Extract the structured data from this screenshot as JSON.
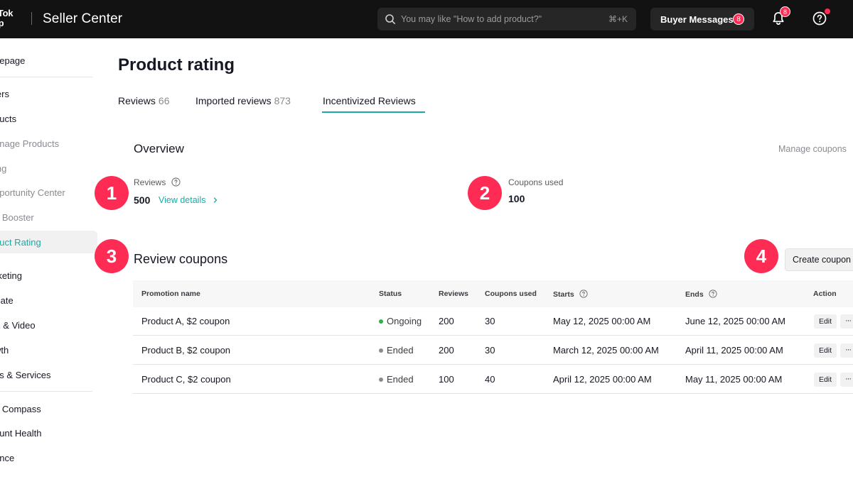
{
  "topbar": {
    "logo_line1": "kTok",
    "logo_line2": "op",
    "brand": "Seller Center",
    "search_placeholder": "You may like \"How to add product?\"",
    "search_shortcut": "⌘+K",
    "buyer_messages_label": "Buyer Messages",
    "buyer_messages_count": "8",
    "notifications_count": "8",
    "icons": [
      "search-icon",
      "bell-icon",
      "help-icon"
    ]
  },
  "sidebar": {
    "items": [
      {
        "label": "nepage"
      },
      {
        "label": "lers"
      },
      {
        "label": "ducts"
      },
      {
        "label": "anage Products"
      },
      {
        "label": "ing"
      },
      {
        "label": "oportunity Center"
      },
      {
        "label": "e Booster"
      },
      {
        "label": "duct Rating"
      },
      {
        "label": "rketing"
      },
      {
        "label": "iliate"
      },
      {
        "label": "E & Video"
      },
      {
        "label": "wth"
      },
      {
        "label": "os & Services"
      },
      {
        "label": "a Compass"
      },
      {
        "label": "ount Health"
      },
      {
        "label": "ance"
      }
    ],
    "active_item": "duct Rating"
  },
  "main": {
    "title": "Product rating",
    "tabs": [
      {
        "label": "Reviews",
        "count": "66"
      },
      {
        "label": "Imported reviews",
        "count": "873"
      },
      {
        "label": "Incentivized Reviews",
        "count": ""
      }
    ],
    "active_tab": "Incentivized Reviews",
    "overview": {
      "title": "Overview",
      "manage_link": "Manage coupons",
      "reviews_label": "Reviews",
      "reviews_value": "500",
      "view_details": "View details",
      "coupons_used_label": "Coupons used",
      "coupons_used_value": "100"
    },
    "markers": [
      "1",
      "2",
      "3",
      "4"
    ],
    "review_coupons": {
      "title": "Review coupons",
      "create_button": "Create coupon",
      "columns": [
        "Promotion name",
        "Status",
        "Reviews",
        "Coupons used",
        "Starts",
        "Ends",
        "Action"
      ],
      "rows": [
        {
          "name": "Product A, $2 coupon",
          "status": "Ongoing",
          "status_color": "#2bb34b",
          "reviews": "200",
          "coupons_used": "30",
          "starts": "May 12, 2025 00:00 AM",
          "ends": "June 12, 2025 00:00 AM",
          "edit": "Edit",
          "more": "···"
        },
        {
          "name": "Product B, $2 coupon",
          "status": "Ended",
          "status_color": "#8a8b91",
          "reviews": "200",
          "coupons_used": "30",
          "starts": "March 12, 2025 00:00 AM",
          "ends": "April 11, 2025 00:00 AM",
          "edit": "Edit",
          "more": "···"
        },
        {
          "name": "Product C, $2 coupon",
          "status": "Ended",
          "status_color": "#8a8b91",
          "reviews": "100",
          "coupons_used": "40",
          "starts": "April 12, 2025 00:00 AM",
          "ends": "May 11, 2025 00:00 AM",
          "edit": "Edit",
          "more": "···"
        }
      ]
    }
  },
  "colors": {
    "accent": "#1aaaa4",
    "marker": "#fe2c55",
    "topbar": "#121212",
    "ongoing": "#2bb34b",
    "ended": "#8a8b91"
  }
}
